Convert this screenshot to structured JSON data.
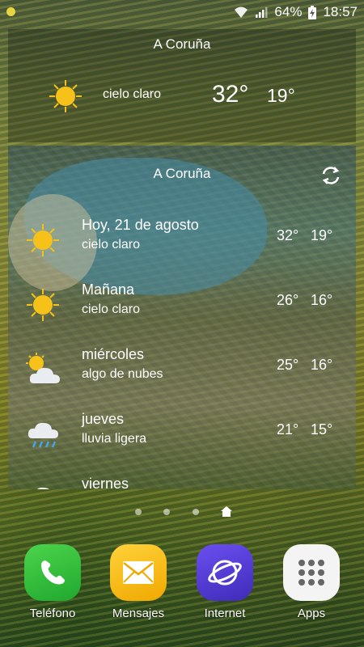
{
  "status_bar": {
    "battery": "64%",
    "time": "18:57",
    "icons": [
      "wifi-icon",
      "signal-icon",
      "battery-charging-icon"
    ]
  },
  "current_widget": {
    "city": "A Coruña",
    "condition": "cielo claro",
    "temp_high": "32°",
    "temp_low": "19°",
    "icon": "sun-icon"
  },
  "forecast_widget": {
    "city": "A Coruña",
    "refresh_icon": "refresh-icon",
    "days": [
      {
        "day": "Hoy, 21 de agosto",
        "condition": "cielo claro",
        "high": "32°",
        "low": "19°",
        "icon": "sun-icon"
      },
      {
        "day": "Mañana",
        "condition": "cielo claro",
        "high": "26°",
        "low": "16°",
        "icon": "sun-icon"
      },
      {
        "day": "miércoles",
        "condition": "algo de nubes",
        "high": "25°",
        "low": "16°",
        "icon": "partly-cloudy-icon"
      },
      {
        "day": "jueves",
        "condition": "lluvia ligera",
        "high": "21°",
        "low": "15°",
        "icon": "rain-icon"
      },
      {
        "day": "viernes",
        "condition": "",
        "high": "",
        "low": "",
        "icon": "cloud-icon"
      }
    ]
  },
  "page_indicator": {
    "pages": 4,
    "active": "home"
  },
  "dock": [
    {
      "label": "Teléfono",
      "icon": "phone-icon",
      "color": "#2bbf3a"
    },
    {
      "label": "Mensajes",
      "icon": "mail-icon",
      "color": "#f5b800"
    },
    {
      "label": "Internet",
      "icon": "globe-icon",
      "color": "#5b3fd6"
    },
    {
      "label": "Apps",
      "icon": "apps-grid-icon",
      "color": "#f2f2f2"
    }
  ],
  "colors": {
    "sun": "#f6c21a",
    "accent_text": "#ffffff"
  }
}
